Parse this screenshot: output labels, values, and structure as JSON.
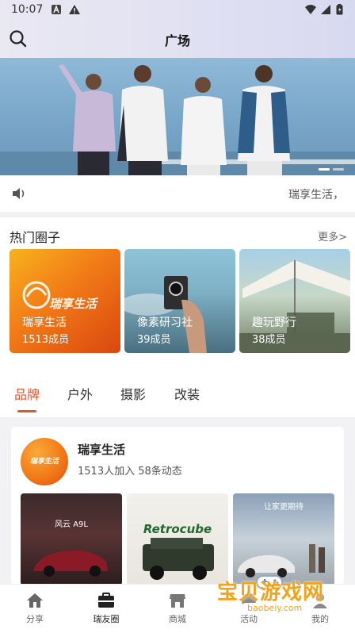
{
  "status": {
    "time": "10:07"
  },
  "header": {
    "title": "广场"
  },
  "notice": {
    "text": "瑞享生活，"
  },
  "hot": {
    "title": "热门圈子",
    "more": "更多>",
    "cards": [
      {
        "name": "瑞享生活",
        "count": "1513成员",
        "logo_text": "瑞享生活"
      },
      {
        "name": "像素研习社",
        "count": "39成员"
      },
      {
        "name": "趣玩野行",
        "count": "38成员"
      }
    ]
  },
  "tabs": [
    "品牌",
    "户外",
    "摄影",
    "改装"
  ],
  "brand": {
    "logo_text": "瑞享生活",
    "name": "瑞享生活",
    "stats": "1513人加入  58条动态",
    "posts": [
      {
        "caption": "风云 A9L"
      },
      {
        "caption": "Retrocube"
      },
      {
        "caption": "让家更期待"
      }
    ]
  },
  "nav": [
    "分享",
    "瑞友圈",
    "商城",
    "活动",
    "我的"
  ],
  "watermark": {
    "main": "宝贝游戏网",
    "sub": "baobeiy.com"
  },
  "colors": {
    "accent": "#e8552c",
    "brand_orange": "#f27a17"
  }
}
